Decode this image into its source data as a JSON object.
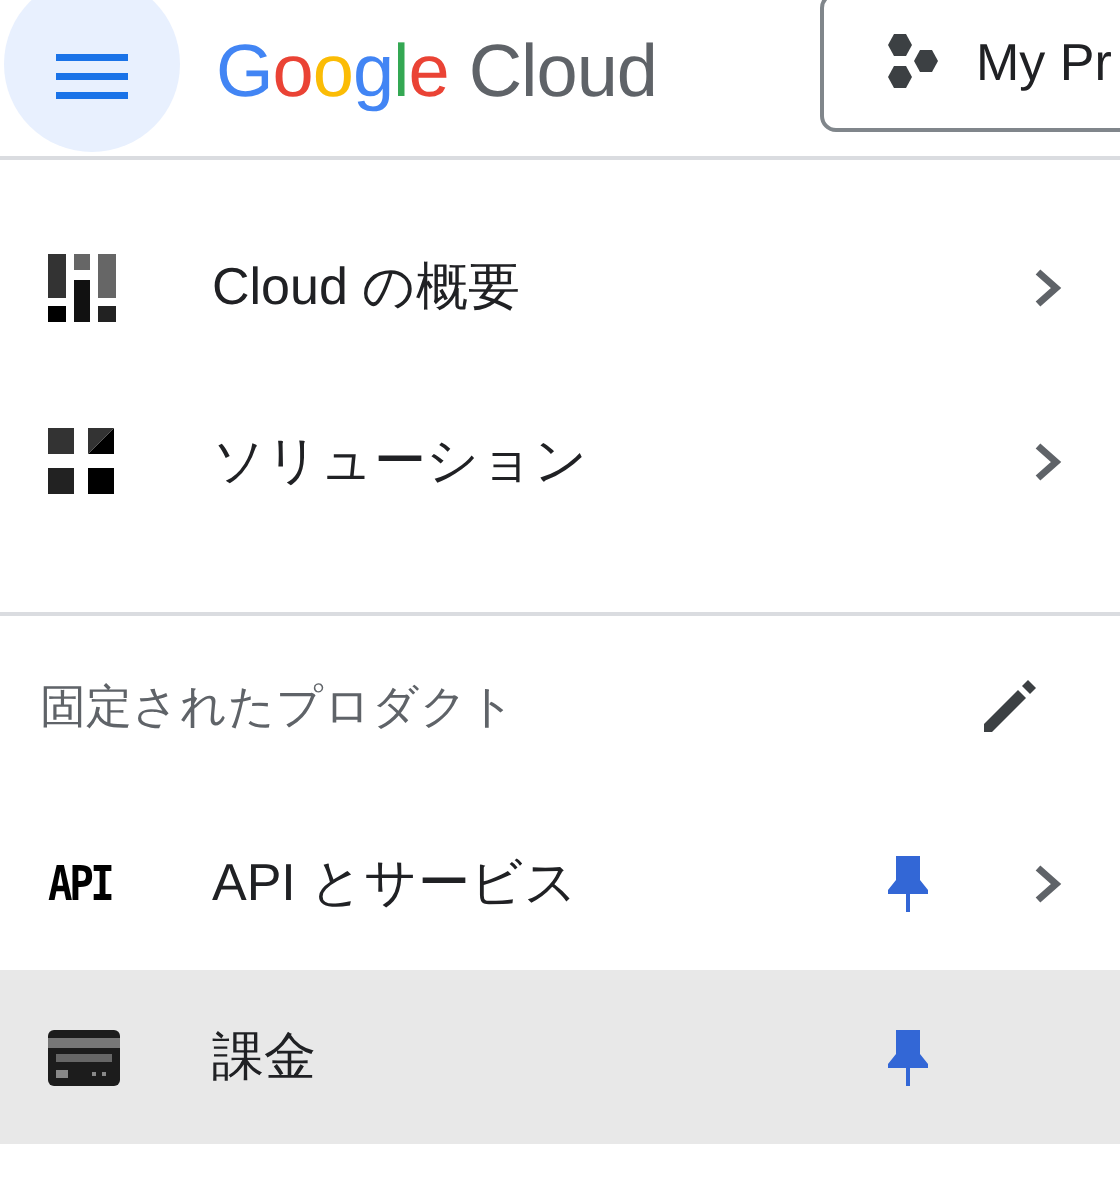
{
  "header": {
    "logo": {
      "brand": "Google",
      "product": "Cloud"
    },
    "project_button": "My Pr"
  },
  "nav_items": [
    {
      "kind": "overview",
      "label": "Cloud の概要",
      "has_submenu": true
    },
    {
      "kind": "solutions",
      "label": "ソリューション",
      "has_submenu": true
    }
  ],
  "pinned": {
    "title": "固定されたプロダクト",
    "items": [
      {
        "kind": "api",
        "icon_text": "API",
        "label": "API とサービス",
        "pinned": true,
        "has_submenu": true,
        "selected": false
      },
      {
        "kind": "billing",
        "label": "課金",
        "pinned": true,
        "has_submenu": false,
        "selected": true
      }
    ]
  }
}
